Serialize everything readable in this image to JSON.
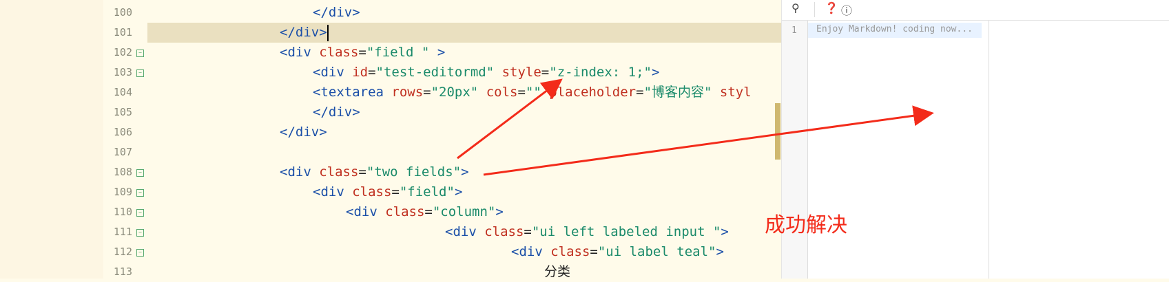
{
  "editor": {
    "lines": [
      {
        "num": "100",
        "fold": false,
        "indent": 1,
        "segs": [
          [
            "tag",
            "</div>"
          ]
        ]
      },
      {
        "num": "101",
        "fold": false,
        "indent": 0,
        "segs": [
          [
            "tag",
            "</div>"
          ]
        ],
        "current": true
      },
      {
        "num": "102",
        "fold": true,
        "indent": 0,
        "segs": [
          [
            "tag",
            "<div "
          ],
          [
            "attr",
            "class"
          ],
          [
            "txt",
            "="
          ],
          [
            "str",
            "\"field \""
          ],
          [
            "tag",
            " >"
          ]
        ]
      },
      {
        "num": "103",
        "fold": true,
        "indent": 1,
        "segs": [
          [
            "tag",
            "<div "
          ],
          [
            "attr",
            "id"
          ],
          [
            "txt",
            "="
          ],
          [
            "str",
            "\"test-editormd\""
          ],
          [
            "txt",
            " "
          ],
          [
            "attr",
            "style"
          ],
          [
            "txt",
            "="
          ],
          [
            "str",
            "\"z-index: 1;\""
          ],
          [
            "tag",
            ">"
          ]
        ]
      },
      {
        "num": "104",
        "fold": false,
        "indent": 1,
        "segs": [
          [
            "tag",
            "<textarea "
          ],
          [
            "attr",
            "rows"
          ],
          [
            "txt",
            "="
          ],
          [
            "str",
            "\"20px\""
          ],
          [
            "txt",
            " "
          ],
          [
            "attr",
            "cols"
          ],
          [
            "txt",
            "="
          ],
          [
            "str",
            "\"\""
          ],
          [
            "txt",
            " "
          ],
          [
            "attr",
            "placeholder"
          ],
          [
            "txt",
            "="
          ],
          [
            "str",
            "\"博客内容\""
          ],
          [
            "txt",
            " "
          ],
          [
            "attr",
            "styl"
          ]
        ]
      },
      {
        "num": "105",
        "fold": false,
        "indent": 1,
        "segs": [
          [
            "tag",
            "</div>"
          ]
        ]
      },
      {
        "num": "106",
        "fold": false,
        "indent": 0,
        "segs": [
          [
            "tag",
            "</div>"
          ]
        ]
      },
      {
        "num": "107",
        "fold": false,
        "indent": 0,
        "segs": []
      },
      {
        "num": "108",
        "fold": true,
        "indent": 0,
        "segs": [
          [
            "tag",
            "<div "
          ],
          [
            "attr",
            "class"
          ],
          [
            "txt",
            "="
          ],
          [
            "str",
            "\"two fields\""
          ],
          [
            "tag",
            ">"
          ]
        ]
      },
      {
        "num": "109",
        "fold": true,
        "indent": 1,
        "segs": [
          [
            "tag",
            "<div "
          ],
          [
            "attr",
            "class"
          ],
          [
            "txt",
            "="
          ],
          [
            "str",
            "\"field\""
          ],
          [
            "tag",
            ">"
          ]
        ]
      },
      {
        "num": "110",
        "fold": true,
        "indent": 2,
        "segs": [
          [
            "tag",
            "<div "
          ],
          [
            "attr",
            "class"
          ],
          [
            "txt",
            "="
          ],
          [
            "str",
            "\"column\""
          ],
          [
            "tag",
            ">"
          ]
        ]
      },
      {
        "num": "111",
        "fold": true,
        "indent": 5,
        "segs": [
          [
            "tag",
            "<div "
          ],
          [
            "attr",
            "class"
          ],
          [
            "txt",
            "="
          ],
          [
            "str",
            "\"ui left labeled input \""
          ],
          [
            "tag",
            ">"
          ]
        ]
      },
      {
        "num": "112",
        "fold": true,
        "indent": 7,
        "segs": [
          [
            "tag",
            "<div "
          ],
          [
            "attr",
            "class"
          ],
          [
            "txt",
            "="
          ],
          [
            "str",
            "\"ui label teal\""
          ],
          [
            "tag",
            ">"
          ]
        ]
      },
      {
        "num": "113",
        "fold": false,
        "indent": 8,
        "segs": [
          [
            "txt",
            "分类"
          ]
        ]
      }
    ]
  },
  "markdown_pane": {
    "line_number": "1",
    "placeholder": "Enjoy Markdown! coding now..."
  },
  "toolbar": {
    "icons": [
      "search-icon",
      "help-icon",
      "info-icon"
    ]
  },
  "annotation": {
    "text": "成功解决",
    "color": "#f32b1a"
  }
}
